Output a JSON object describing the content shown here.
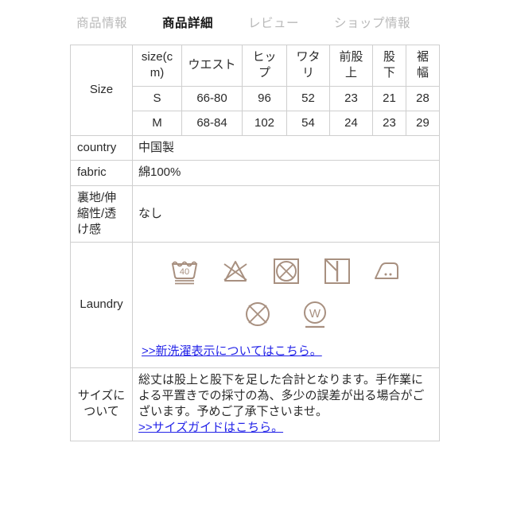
{
  "tabs": [
    {
      "label": "商品情報",
      "active": false
    },
    {
      "label": "商品詳細",
      "active": true
    },
    {
      "label": "レビュー",
      "active": false
    },
    {
      "label": "ショップ情報",
      "active": false
    }
  ],
  "colors": {
    "tab_active": "#141414",
    "tab_inactive": "#b9b9b9",
    "border": "#cfcfcf",
    "icon": "#a89080",
    "link": "#2424e8"
  },
  "spec": {
    "size_label": "Size",
    "size_headers": [
      "size(cm)",
      "ウエスト",
      "ヒップ",
      "ワタリ",
      "前股上",
      "股下",
      "裾幅"
    ],
    "size_rows": [
      [
        "S",
        "66-80",
        "96",
        "52",
        "23",
        "21",
        "28"
      ],
      [
        "M",
        "68-84",
        "102",
        "54",
        "24",
        "23",
        "29"
      ]
    ],
    "country_label": "country",
    "country_value": "中国製",
    "fabric_label": "fabric",
    "fabric_value": "綿100%",
    "lining_label": "裏地/伸縮性/透け感",
    "lining_value": "なし",
    "laundry_label": "Laundry",
    "laundry_icons_row1": [
      {
        "name": "wash-40-delicate-icon",
        "alt": "洗濯40度弱",
        "text": "40"
      },
      {
        "name": "do-not-bleach-icon",
        "alt": "塩素漂白禁止",
        "text": ""
      },
      {
        "name": "do-not-tumble-dry-icon",
        "alt": "タンブル乾燥禁止",
        "text": ""
      },
      {
        "name": "drip-dry-in-shade-icon",
        "alt": "陰干し",
        "text": ""
      },
      {
        "name": "iron-medium-icon",
        "alt": "中温アイロン",
        "text": ""
      }
    ],
    "laundry_icons_row2": [
      {
        "name": "do-not-dryclean-icon",
        "alt": "ドライクリーニング禁止",
        "text": ""
      },
      {
        "name": "wetclean-gentle-icon",
        "alt": "ウェットクリーニング弱",
        "text": "W"
      }
    ],
    "laundry_link": ">>新洗濯表示についてはこちら。",
    "sizenote_label": "サイズについて",
    "sizenote_text": "総丈は股上と股下を足した合計となります。手作業による平置きでの採寸の為、多少の誤差が出る場合がございます。予めご了承下さいませ。",
    "sizenote_link": ">>サイズガイドはこちら。"
  }
}
